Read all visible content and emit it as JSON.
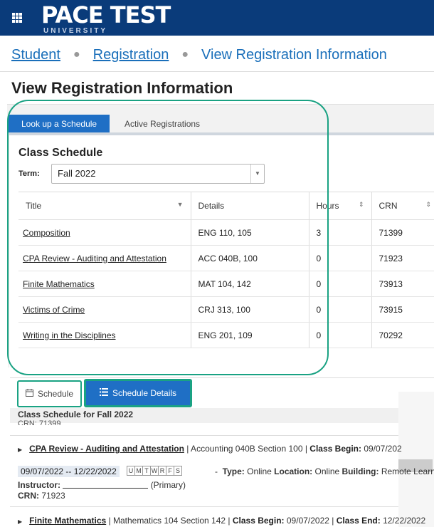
{
  "header": {
    "brand_main": "PACE TEST",
    "brand_sub": "UNIVERSITY"
  },
  "breadcrumb": {
    "items": [
      "Student",
      "Registration",
      "View Registration Information"
    ]
  },
  "page_title": "View Registration Information",
  "tabs": [
    {
      "label": "Look up a Schedule",
      "active": true
    },
    {
      "label": "Active Registrations",
      "active": false
    }
  ],
  "class_schedule": {
    "title": "Class Schedule",
    "term_label": "Term:",
    "term_value": "Fall 2022",
    "columns": [
      "Title",
      "Details",
      "Hours",
      "CRN"
    ],
    "rows": [
      {
        "title": "Composition",
        "details": "ENG 110, 105",
        "hours": "3",
        "crn": "71399"
      },
      {
        "title": "CPA Review - Auditing and Attestation",
        "details": "ACC 040B, 100",
        "hours": "0",
        "crn": "71923"
      },
      {
        "title": "Finite Mathematics",
        "details": "MAT 104, 142",
        "hours": "0",
        "crn": "73913"
      },
      {
        "title": "Victims of Crime",
        "details": "CRJ 313, 100",
        "hours": "0",
        "crn": "73915"
      },
      {
        "title": "Writing in the Disciplines",
        "details": "ENG 201, 109",
        "hours": "0",
        "crn": "70292"
      }
    ]
  },
  "view_buttons": {
    "schedule": "Schedule",
    "schedule_details": "Schedule Details"
  },
  "details": {
    "header": "Class Schedule for Fall 2022",
    "crn_cut": "CRN: 71399",
    "course1": {
      "title": "CPA Review - Auditing and Attestation",
      "info": " | Accounting 040B Section 100 | ",
      "begin_label": "Class Begin:",
      "begin_value": " 09/07/202",
      "dates": "09/07/2022 -- 12/22/2022",
      "days": [
        "U",
        "M",
        "T",
        "W",
        "R",
        "F",
        "S"
      ],
      "type_label": "Type:",
      "type_value": " Online ",
      "location_label": "Location:",
      "location_value": " Online ",
      "building_label": "Building:",
      "building_value": " Remote Learni",
      "instructor_label": "Instructor:",
      "instructor_suffix": " (Primary)",
      "crn_label": "CRN:",
      "crn_value": " 71923"
    },
    "course2": {
      "title": "Finite Mathematics",
      "info": " | Mathematics 104 Section 142 | ",
      "begin_label": "Class Begin:",
      "begin_value": " 09/07/2022 | ",
      "end_label": "Class End:",
      "end_value": " 12/22/2022"
    }
  }
}
